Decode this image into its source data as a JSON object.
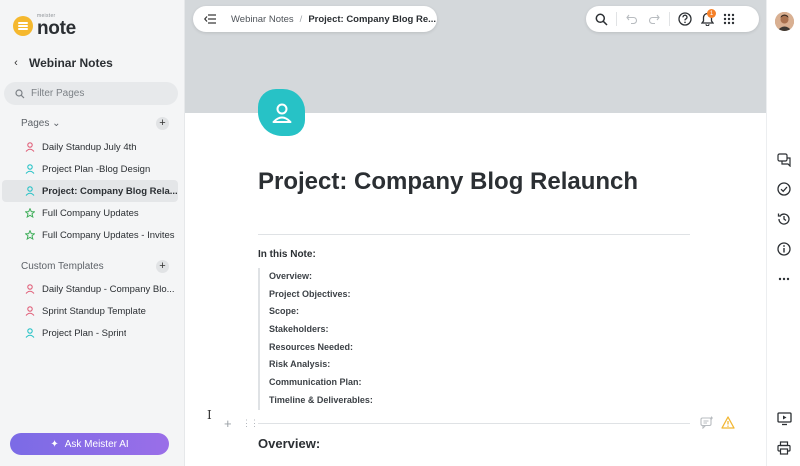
{
  "app": {
    "logo_small": "meister",
    "logo_name": "note"
  },
  "sidebar": {
    "back_title": "Webinar Notes",
    "filter_placeholder": "Filter Pages",
    "pages_label": "Pages",
    "pages": [
      {
        "label": "Daily Standup July 4th",
        "icon": "person-icon",
        "color": "#e0607a"
      },
      {
        "label": "Project Plan -Blog Design",
        "icon": "person-icon",
        "color": "#27c2c6"
      },
      {
        "label": "Project: Company Blog Rela...",
        "icon": "person-icon",
        "color": "#27c2c6",
        "active": true
      },
      {
        "label": "Full Company Updates",
        "icon": "star-icon",
        "color": "#3fae5a"
      },
      {
        "label": "Full Company Updates - Invites",
        "icon": "star-icon",
        "color": "#3fae5a"
      }
    ],
    "templates_label": "Custom Templates",
    "templates": [
      {
        "label": "Daily Standup - Company Blo...",
        "icon": "person-icon",
        "color": "#e0607a"
      },
      {
        "label": "Sprint Standup Template",
        "icon": "person-icon",
        "color": "#e0607a"
      },
      {
        "label": "Project Plan - Sprint",
        "icon": "person-icon",
        "color": "#27c2c6"
      }
    ],
    "ask_ai_label": "Ask Meister AI"
  },
  "topbar": {
    "breadcrumb_parent": "Webinar Notes",
    "breadcrumb_sep": "/",
    "breadcrumb_current": "Project: Company Blog Re...",
    "notification_count": "1"
  },
  "document": {
    "title": "Project: Company Blog Relaunch",
    "toc_title": "In this Note:",
    "toc": [
      "Overview:",
      "Project Objectives:",
      "Scope:",
      "Stakeholders:",
      "Resources Needed:",
      "Risk Analysis:",
      "Communication Plan:",
      "Timeline & Deliverables:"
    ],
    "section_heading": "Overview:"
  },
  "colors": {
    "accent_teal": "#27c2c6",
    "ai_button": "#8a6de8",
    "badge": "#f5812a",
    "warning": "#f2b632"
  }
}
